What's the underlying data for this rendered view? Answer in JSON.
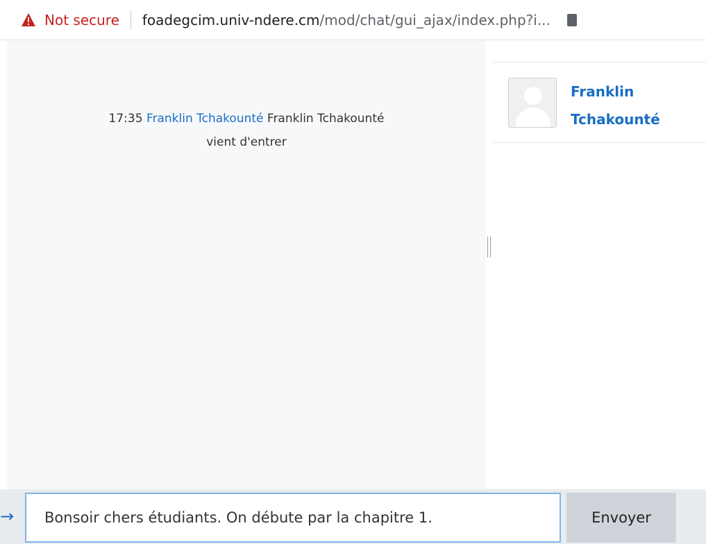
{
  "browser": {
    "security_label": "Not secure",
    "url_host": "foadegcim.univ-ndere.cm",
    "url_path": "/mod/chat/gui_ajax/index.php?i...",
    "warning_color": "#c5221f"
  },
  "chat": {
    "messages": [
      {
        "time": "17:35",
        "user": "Franklin Tchakounté",
        "text_line1": "Franklin Tchakounté",
        "text_line2": "vient d'entrer"
      }
    ],
    "users": [
      {
        "name": "Franklin Tchakounté",
        "avatar": "default-user-avatar"
      }
    ],
    "input_value": "Bonsoir chers étudiants. On débute par la chapitre 1.",
    "send_label": "Envoyer"
  },
  "colors": {
    "link_blue": "#1a6ec2",
    "message_pane_bg": "#f7f8fa",
    "bottom_bar_bg": "#e9ecef",
    "input_focus_border": "#80b4e8",
    "send_button_bg": "#ced4da"
  },
  "icons": {
    "address_bar": "warning-triangle-icon",
    "cursor_arrow": "arrow-right-icon"
  }
}
